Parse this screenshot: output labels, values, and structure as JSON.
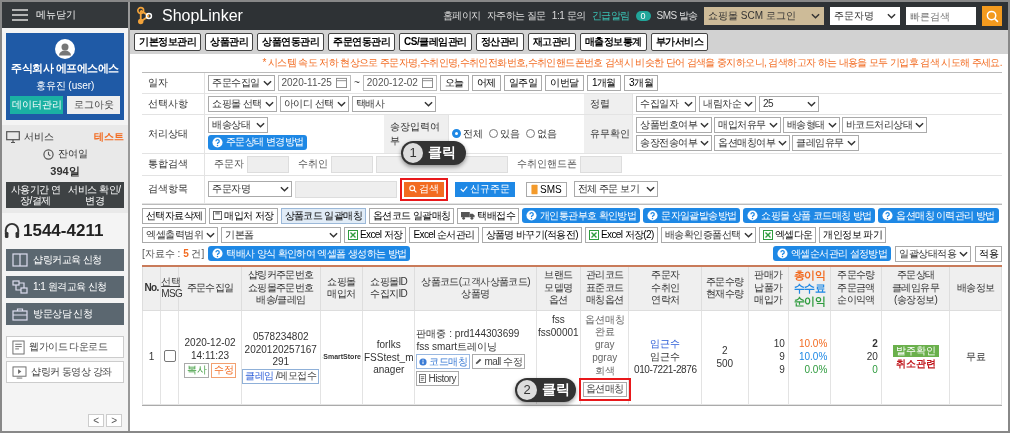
{
  "sidebar": {
    "toggle": "메뉴닫기",
    "profile": {
      "company": "주식회사 에프에스에스",
      "user": "홍유진 (user)",
      "buttons": [
        "데이터관리",
        "로그아웃"
      ]
    },
    "service": {
      "label": "서비스",
      "badge": "테스트",
      "remaining_label": "잔여일",
      "remaining": "394일",
      "buttons": [
        "사용기간 연장/결제",
        "서비스 확인/변경"
      ]
    },
    "phone": "1544-4211",
    "menu": [
      {
        "kind": "book",
        "label": "샵링커교육 신청"
      },
      {
        "kind": "remote",
        "label": "1:1 원격교육 신청"
      },
      {
        "kind": "briefcase",
        "label": "방문상담 신청"
      }
    ],
    "links": [
      {
        "kind": "document",
        "label": "웹가이드 다운로드"
      },
      {
        "kind": "video",
        "label": "샵링커 동영상 강좌"
      }
    ],
    "pager": [
      "<",
      ">"
    ]
  },
  "header": {
    "logo": "ShopLinker",
    "links": [
      "홈페이지",
      "자주하는 질문",
      "1:1 문의"
    ],
    "alert": {
      "label": "긴급알림",
      "count": "0"
    },
    "sms": "SMS 발송",
    "scm_select": "쇼핑몰 SCM 로그인",
    "search_type": "주문자명",
    "search": {
      "placeholder": "빠른검색"
    }
  },
  "nav": [
    "기본정보관리",
    "상품관리",
    "상품연동관리",
    "주문연동관리",
    "CS/클레임관리",
    "정산관리",
    "재고관리",
    "매출정보통계",
    "부가서비스"
  ],
  "notice": "* 시스템 속도 저하 현상으로 주문자명,수취인명,수취인전화번호,수취인핸드폰번호 검색시 비슷한 단어 검색을 중지하오니, 검색하고자 하는 내용을 모두 기입후 검색 시도해 주세요.",
  "filters": {
    "date": {
      "label": "일자",
      "type": "주문수집일",
      "from": "2020-11-25",
      "sep": "~",
      "to": "2020-12-02",
      "quick": [
        "오늘",
        "어제",
        "일주일",
        "이번달",
        "1개월",
        "3개월"
      ]
    },
    "options": {
      "label": "선택사항",
      "selects": [
        "쇼핑몰 선택",
        "아이디 선택",
        "택배사"
      ]
    },
    "sort": {
      "label": "정렬",
      "selects": [
        "수집일자",
        "내림차순",
        "25"
      ]
    },
    "status": {
      "label": "처리상태",
      "select": "배송상태",
      "help": "주문상태 변경방법"
    },
    "invoice": {
      "label": "송장입력여부",
      "options": [
        {
          "label": "전체",
          "selected": true
        },
        {
          "label": "있음",
          "selected": false
        },
        {
          "label": "없음",
          "selected": false
        }
      ]
    },
    "check": {
      "label": "유무확인",
      "selects": [
        "상품번호여부",
        "매입처유무",
        "배송형태",
        "바코드처리상태",
        "송장전송여부",
        "옵션매칭여부",
        "클레임유무"
      ]
    },
    "combined": {
      "label": "통합검색",
      "fields": [
        {
          "kind": "labeled",
          "label": "주문자"
        },
        {
          "kind": "labeled",
          "label": "수취인"
        },
        {
          "kind": "bare"
        },
        {
          "kind": "labeled",
          "label": "수취인핸드폰"
        }
      ]
    },
    "search": {
      "label": "검색항목",
      "select": "주문자명",
      "buttons": [
        {
          "kind": "search",
          "label": "검색",
          "highlighted": true
        },
        {
          "kind": "new",
          "label": "신규주문",
          "highlighted": false
        },
        {
          "kind": "sms",
          "label": "SMS",
          "highlighted": false
        }
      ],
      "view": "전체 주문 보기"
    }
  },
  "actions": {
    "row1": [
      {
        "kind": "plain",
        "label": "선택자료삭제"
      },
      {
        "kind": "save",
        "label": "매입처 저장"
      },
      {
        "kind": "accent",
        "label": "상품코드 일괄매칭"
      },
      {
        "kind": "plain",
        "label": "옵션코드 일괄매칭"
      },
      {
        "kind": "truck",
        "label": "택배접수"
      },
      {
        "kind": "help",
        "label": "개인통관부호 확인방법"
      },
      {
        "kind": "help",
        "label": "문자일괄발송방법"
      },
      {
        "kind": "help",
        "label": "쇼핑몰 상품 코드매칭 방법"
      },
      {
        "kind": "help",
        "label": "옵션매칭 이력관리 방법"
      }
    ],
    "row2": [
      {
        "kind": "select",
        "label": "엑셀출력범위"
      },
      {
        "kind": "wide-select",
        "label": "기본폼"
      },
      {
        "kind": "excel",
        "label": "Excel 저장"
      },
      {
        "kind": "plain",
        "label": "Excel 순서관리"
      },
      {
        "kind": "plain",
        "label": "상품명 바꾸기(적용전)"
      },
      {
        "kind": "excel",
        "label": "Excel 저장(2)"
      },
      {
        "kind": "select",
        "label": "배송확인증품선택"
      },
      {
        "kind": "excel",
        "label": "엑셀다운"
      },
      {
        "kind": "plain",
        "label": "개인정보 파기"
      }
    ]
  },
  "results": {
    "prefix": "[자료수 :",
    "count": "5",
    "suffix": "건]",
    "help": "택배사 양식 확인하여 엑셀폼 생성하는 방법",
    "right_help": "엑셀순서관리 설정방법",
    "bulk_select": "일괄상태적용",
    "apply": "적용"
  },
  "table": {
    "columns": [
      {
        "lines": [
          "No."
        ]
      },
      {
        "lines": [
          {
            "text": "선택",
            "underlined": true
          },
          {
            "text": "MSG",
            "underlined": false
          }
        ]
      },
      {
        "lines": [
          "주문수집일"
        ]
      },
      {
        "lines": [
          "샵링커주문번호",
          "쇼핑몰주문번호",
          "배송/클레임"
        ]
      },
      {
        "lines": [
          "쇼핑몰",
          "매입처"
        ]
      },
      {
        "lines": [
          "쇼핑몰ID",
          "수집지ID"
        ]
      },
      {
        "lines": [
          "상품코드(고객사상품코드)",
          "상품명"
        ]
      },
      {
        "lines": [
          "브랜드",
          "모델명",
          "옵션"
        ]
      },
      {
        "lines": [
          "관리코드",
          "표준코드",
          "매칭옵션"
        ]
      },
      {
        "lines": [
          "주문자",
          "수취인",
          "연락처"
        ]
      },
      {
        "lines": [
          "주문수량",
          "현재수량"
        ]
      },
      {
        "lines": [
          "판매가",
          "납품가",
          "매입가"
        ]
      },
      {
        "lines": [
          {
            "text": "총이익",
            "color": "#f26b21"
          },
          {
            "text": "수수료",
            "color": "#1e88e5"
          },
          {
            "text": "순이익",
            "color": "#2e9b3e"
          }
        ]
      },
      {
        "lines": [
          "주문수량",
          "주문금액",
          "순이익액"
        ]
      },
      {
        "lines": [
          "주문상태",
          "클레임유무",
          "(송장정보)"
        ]
      },
      {
        "lines": [
          "배송정보"
        ]
      }
    ],
    "rows": [
      {
        "no": "1",
        "checked": false,
        "date": "2020-12-02",
        "time": "14:11:23",
        "date_buttons": [
          {
            "kind": "copy",
            "label": "복사"
          },
          {
            "kind": "edit",
            "label": "수정"
          }
        ],
        "order_no": "0578234802",
        "mall_order_no": "2020120257167291",
        "claim": {
          "link": "클레임",
          "rest": "/메모접수"
        },
        "mall": "SmartStore",
        "mall_id": "forlks",
        "collector_id": "FSStest_manager",
        "product_status": "판매중 : prd144303699",
        "product_name": "fss smart트레이닝",
        "product_buttons": [
          {
            "kind": "match",
            "label": "코드매칭"
          },
          {
            "kind": "mall-edit",
            "label": "mall 수정"
          },
          {
            "kind": "history",
            "label": "History"
          }
        ],
        "brand": "fss",
        "model": "fss00001",
        "mgmt": [
          "옵션매칭완료",
          "gray",
          "pgray",
          "회색"
        ],
        "mgmt_button": {
          "label": "옵션매칭",
          "highlighted": true
        },
        "orderer": "임근수",
        "receiver": "임근수",
        "phone": "010-7221-2876",
        "qty": "2",
        "stock": "500",
        "prices": [
          "10",
          "9",
          "9"
        ],
        "profits": [
          "10.0%",
          "10.0%",
          "0.0%"
        ],
        "amounts": [
          "2",
          "20",
          "0"
        ],
        "status": "발주확인",
        "claim_status": "취소관련",
        "delivery": "무료"
      }
    ]
  },
  "callouts": [
    {
      "number": "1",
      "text": "클릭"
    },
    {
      "number": "2",
      "text": "클릭"
    }
  ]
}
